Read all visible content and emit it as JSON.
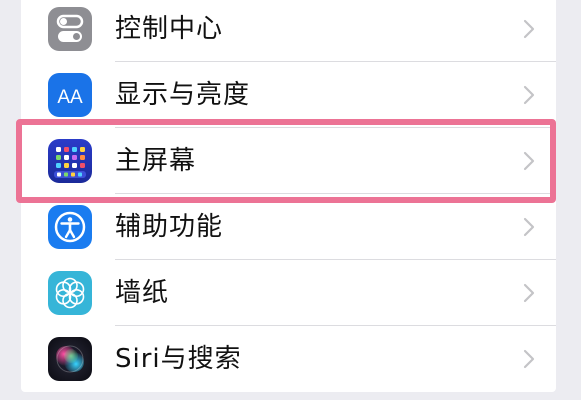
{
  "settings": {
    "items": [
      {
        "label": "控制中心",
        "icon": "control-center-icon"
      },
      {
        "label": "显示与亮度",
        "icon": "display-brightness-icon"
      },
      {
        "label": "主屏幕",
        "icon": "home-screen-icon"
      },
      {
        "label": "辅助功能",
        "icon": "accessibility-icon"
      },
      {
        "label": "墙纸",
        "icon": "wallpaper-icon"
      },
      {
        "label": "Siri与搜索",
        "icon": "siri-icon"
      }
    ],
    "display_icon_text": "AA",
    "highlighted_item": "主屏幕",
    "colors": {
      "highlight_border": "#ec7395",
      "background": "#ececf1",
      "accent_blue": "#1a73e8"
    }
  }
}
